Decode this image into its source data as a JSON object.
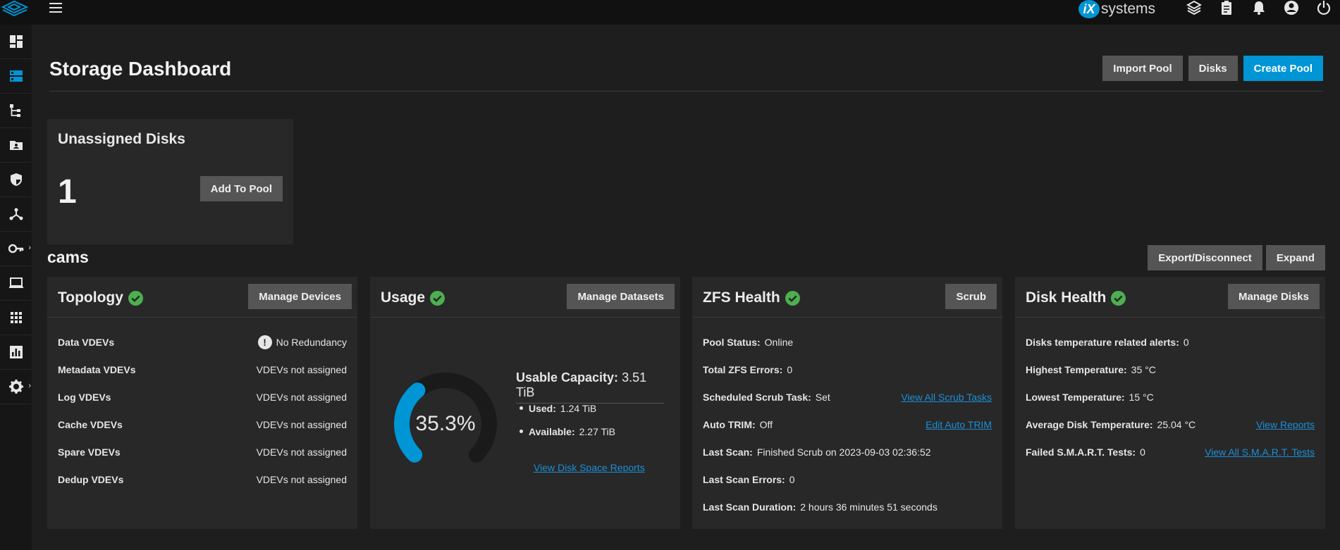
{
  "brand": {
    "prefix": "iX",
    "name": "systems"
  },
  "topbar": {
    "icons": [
      "truecommand-icon",
      "clipboard-icon",
      "bell-icon",
      "account-icon",
      "power-icon"
    ]
  },
  "sidebar": {
    "items": [
      "dashboard-icon",
      "storage-icon",
      "datasets-icon",
      "shares-icon",
      "data-protection-icon",
      "network-icon",
      "credentials-icon",
      "virtualization-icon",
      "apps-icon",
      "reporting-icon",
      "system-settings-icon"
    ]
  },
  "page": {
    "title": "Storage Dashboard",
    "import_pool": "Import Pool",
    "disks": "Disks",
    "create_pool": "Create Pool"
  },
  "unassigned": {
    "title": "Unassigned Disks",
    "count": "1",
    "add_to_pool": "Add To Pool"
  },
  "pool": {
    "name": "cams",
    "export": "Export/Disconnect",
    "expand": "Expand",
    "topology": {
      "title": "Topology",
      "button": "Manage Devices",
      "rows": [
        {
          "label": "Data VDEVs",
          "value": "No Redundancy"
        },
        {
          "label": "Metadata VDEVs",
          "value": "VDEVs not assigned"
        },
        {
          "label": "Log VDEVs",
          "value": "VDEVs not assigned"
        },
        {
          "label": "Cache VDEVs",
          "value": "VDEVs not assigned"
        },
        {
          "label": "Spare VDEVs",
          "value": "VDEVs not assigned"
        },
        {
          "label": "Dedup VDEVs",
          "value": "VDEVs not assigned"
        }
      ]
    },
    "usage": {
      "title": "Usage",
      "button": "Manage Datasets",
      "percent_text": "35.3%",
      "percent": 35.3,
      "capacity_label": "Usable Capacity:",
      "capacity_value": "3.51 TiB",
      "used_label": "Used:",
      "used_value": "1.24 TiB",
      "available_label": "Available:",
      "available_value": "2.27 TiB",
      "link": "View Disk Space Reports"
    },
    "zfs": {
      "title": "ZFS Health",
      "button": "Scrub",
      "rows": [
        {
          "label": "Pool Status:",
          "value": "Online",
          "link": ""
        },
        {
          "label": "Total ZFS Errors:",
          "value": "0",
          "link": ""
        },
        {
          "label": "Scheduled Scrub Task:",
          "value": "Set",
          "link": "View All Scrub Tasks"
        },
        {
          "label": "Auto TRIM:",
          "value": "Off",
          "link": "Edit Auto TRIM"
        },
        {
          "label": "Last Scan:",
          "value": "Finished Scrub on 2023-09-03 02:36:52",
          "link": ""
        },
        {
          "label": "Last Scan Errors:",
          "value": "0",
          "link": ""
        },
        {
          "label": "Last Scan Duration:",
          "value": "2 hours 36 minutes 51 seconds",
          "link": ""
        }
      ]
    },
    "disk_health": {
      "title": "Disk Health",
      "button": "Manage Disks",
      "rows": [
        {
          "label": "Disks temperature related alerts:",
          "value": "0",
          "link": ""
        },
        {
          "label": "Highest Temperature:",
          "value": "35 °C",
          "link": ""
        },
        {
          "label": "Lowest Temperature:",
          "value": "15 °C",
          "link": ""
        },
        {
          "label": "Average Disk Temperature:",
          "value": "25.04 °C",
          "link": "View Reports"
        },
        {
          "label": "Failed S.M.A.R.T. Tests:",
          "value": "0",
          "link": "View All S.M.A.R.T. Tests"
        }
      ]
    }
  },
  "colors": {
    "accent": "#0095d5",
    "ok": "#4caf50",
    "link": "#1a8fd8",
    "gauge_track": "#1a1a1a"
  }
}
